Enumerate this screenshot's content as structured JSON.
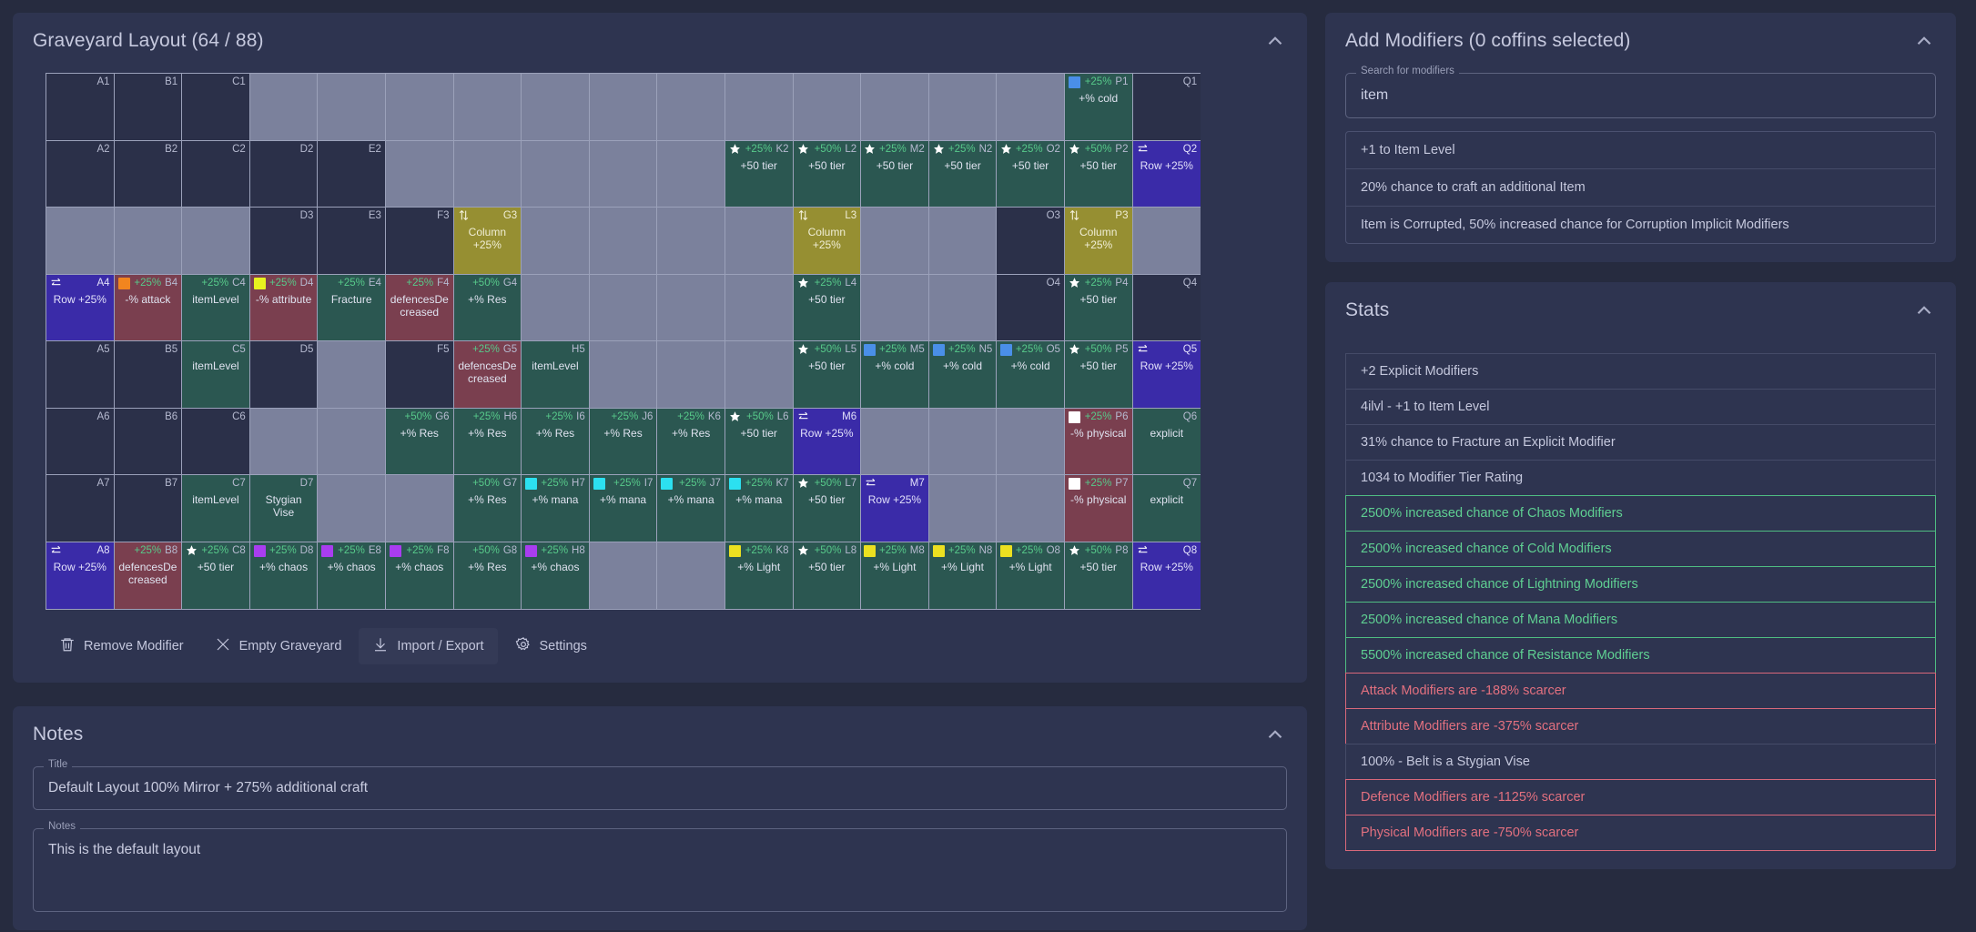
{
  "graveyard": {
    "title": "Graveyard Layout (64 / 88)",
    "collapse_icon": "chevron-up-icon",
    "columns": [
      "A",
      "B",
      "C",
      "D",
      "E",
      "F",
      "G",
      "H",
      "I",
      "J",
      "K",
      "L",
      "M",
      "N",
      "O",
      "P",
      "Q"
    ],
    "rows": 8,
    "cells": [
      [
        {
          "id": "A1",
          "state": "avail"
        },
        {
          "id": "B1",
          "state": "avail"
        },
        {
          "id": "C1",
          "state": "avail"
        },
        {
          "id": "",
          "state": "empty"
        },
        {
          "id": "",
          "state": "empty"
        },
        {
          "id": "",
          "state": "empty"
        },
        {
          "id": "",
          "state": "empty"
        },
        {
          "id": "",
          "state": "empty"
        },
        {
          "id": "",
          "state": "empty"
        },
        {
          "id": "",
          "state": "empty"
        },
        {
          "id": "",
          "state": "empty"
        },
        {
          "id": "",
          "state": "empty"
        },
        {
          "id": "",
          "state": "empty"
        },
        {
          "id": "",
          "state": "empty"
        },
        {
          "id": "",
          "state": "empty"
        },
        {
          "id": "P1",
          "state": "mod-green",
          "pct": "+25%",
          "label": "+% cold",
          "swatch": "#4a8fe8"
        },
        {
          "id": "Q1",
          "state": "avail"
        }
      ],
      [
        {
          "id": "A2",
          "state": "avail"
        },
        {
          "id": "B2",
          "state": "avail"
        },
        {
          "id": "C2",
          "state": "avail"
        },
        {
          "id": "D2",
          "state": "avail"
        },
        {
          "id": "E2",
          "state": "avail"
        },
        {
          "id": "",
          "state": "empty"
        },
        {
          "id": "",
          "state": "empty"
        },
        {
          "id": "",
          "state": "empty"
        },
        {
          "id": "",
          "state": "empty"
        },
        {
          "id": "",
          "state": "empty"
        },
        {
          "id": "K2",
          "state": "mod-green",
          "pct": "+25%",
          "label": "+50 tier",
          "icon": "star-icon"
        },
        {
          "id": "L2",
          "state": "mod-green",
          "pct": "+50%",
          "label": "+50 tier",
          "icon": "star-icon"
        },
        {
          "id": "M2",
          "state": "mod-green",
          "pct": "+25%",
          "label": "+50 tier",
          "icon": "star-icon"
        },
        {
          "id": "N2",
          "state": "mod-green",
          "pct": "+25%",
          "label": "+50 tier",
          "icon": "star-icon"
        },
        {
          "id": "O2",
          "state": "mod-green",
          "pct": "+25%",
          "label": "+50 tier",
          "icon": "star-icon"
        },
        {
          "id": "P2",
          "state": "mod-green",
          "pct": "+50%",
          "label": "+50 tier",
          "icon": "star-icon"
        },
        {
          "id": "Q2",
          "state": "mod-purple",
          "label": "Row +25%",
          "icon": "row-swap-icon"
        }
      ],
      [
        {
          "id": "",
          "state": "empty"
        },
        {
          "id": "",
          "state": "empty"
        },
        {
          "id": "",
          "state": "empty"
        },
        {
          "id": "D3",
          "state": "avail"
        },
        {
          "id": "E3",
          "state": "avail"
        },
        {
          "id": "F3",
          "state": "avail"
        },
        {
          "id": "G3",
          "state": "mod-gold",
          "label": "Column +25%",
          "icon": "column-arrows-icon"
        },
        {
          "id": "",
          "state": "empty"
        },
        {
          "id": "",
          "state": "empty"
        },
        {
          "id": "",
          "state": "empty"
        },
        {
          "id": "",
          "state": "empty"
        },
        {
          "id": "L3",
          "state": "mod-gold",
          "label": "Column +25%",
          "icon": "column-arrows-icon"
        },
        {
          "id": "",
          "state": "empty"
        },
        {
          "id": "",
          "state": "empty"
        },
        {
          "id": "O3",
          "state": "avail"
        },
        {
          "id": "P3",
          "state": "mod-gold",
          "label": "Column +25%",
          "icon": "column-arrows-icon"
        },
        {
          "id": "",
          "state": "empty"
        }
      ],
      [
        {
          "id": "A4",
          "state": "mod-purple",
          "label": "Row +25%",
          "icon": "row-swap-icon"
        },
        {
          "id": "B4",
          "state": "mod-red",
          "pct": "+25%",
          "label": "-% attack",
          "swatch": "#f2851f"
        },
        {
          "id": "C4",
          "state": "mod-green",
          "pct": "+25%",
          "label": "itemLevel"
        },
        {
          "id": "D4",
          "state": "mod-red",
          "pct": "+25%",
          "label": "-% attribute",
          "swatch": "#e8f21f"
        },
        {
          "id": "E4",
          "state": "mod-green",
          "pct": "+25%",
          "label": "Fracture"
        },
        {
          "id": "F4",
          "state": "mod-red",
          "pct": "+25%",
          "label": "defencesDecreased"
        },
        {
          "id": "G4",
          "state": "mod-green",
          "pct": "+50%",
          "label": "+% Res"
        },
        {
          "id": "",
          "state": "empty"
        },
        {
          "id": "",
          "state": "empty"
        },
        {
          "id": "",
          "state": "empty"
        },
        {
          "id": "",
          "state": "empty"
        },
        {
          "id": "L4",
          "state": "mod-green",
          "pct": "+25%",
          "label": "+50 tier",
          "icon": "star-icon"
        },
        {
          "id": "",
          "state": "empty"
        },
        {
          "id": "",
          "state": "empty"
        },
        {
          "id": "O4",
          "state": "avail"
        },
        {
          "id": "P4",
          "state": "mod-green",
          "pct": "+25%",
          "label": "+50 tier",
          "icon": "star-icon"
        },
        {
          "id": "Q4",
          "state": "avail"
        }
      ],
      [
        {
          "id": "A5",
          "state": "avail"
        },
        {
          "id": "B5",
          "state": "avail"
        },
        {
          "id": "C5",
          "state": "mod-green",
          "label": "itemLevel"
        },
        {
          "id": "D5",
          "state": "avail"
        },
        {
          "id": "",
          "state": "empty"
        },
        {
          "id": "F5",
          "state": "avail"
        },
        {
          "id": "G5",
          "state": "mod-red",
          "pct": "+25%",
          "label": "defencesDecreased"
        },
        {
          "id": "H5",
          "state": "mod-green",
          "label": "itemLevel"
        },
        {
          "id": "",
          "state": "empty"
        },
        {
          "id": "",
          "state": "empty"
        },
        {
          "id": "",
          "state": "empty"
        },
        {
          "id": "L5",
          "state": "mod-green",
          "pct": "+50%",
          "label": "+50 tier",
          "icon": "star-icon"
        },
        {
          "id": "M5",
          "state": "mod-green",
          "pct": "+25%",
          "label": "+% cold",
          "swatch": "#4a8fe8"
        },
        {
          "id": "N5",
          "state": "mod-green",
          "pct": "+25%",
          "label": "+% cold",
          "swatch": "#4a8fe8"
        },
        {
          "id": "O5",
          "state": "mod-green",
          "pct": "+25%",
          "label": "+% cold",
          "swatch": "#4a8fe8"
        },
        {
          "id": "P5",
          "state": "mod-green",
          "pct": "+50%",
          "label": "+50 tier",
          "icon": "star-icon"
        },
        {
          "id": "Q5",
          "state": "mod-purple",
          "label": "Row +25%",
          "icon": "row-swap-icon"
        }
      ],
      [
        {
          "id": "A6",
          "state": "avail"
        },
        {
          "id": "B6",
          "state": "avail"
        },
        {
          "id": "C6",
          "state": "avail"
        },
        {
          "id": "",
          "state": "empty"
        },
        {
          "id": "",
          "state": "empty"
        },
        {
          "id": "G6",
          "state": "mod-green",
          "pct": "+50%",
          "label": "+% Res"
        },
        {
          "id": "H6",
          "state": "mod-green",
          "pct": "+25%",
          "label": "+% Res"
        },
        {
          "id": "I6",
          "state": "mod-green",
          "pct": "+25%",
          "label": "+% Res"
        },
        {
          "id": "J6",
          "state": "mod-green",
          "pct": "+25%",
          "label": "+% Res"
        },
        {
          "id": "K6",
          "state": "mod-green",
          "pct": "+25%",
          "label": "+% Res"
        },
        {
          "id": "L6",
          "state": "mod-green",
          "pct": "+50%",
          "label": "+50 tier",
          "icon": "star-icon"
        },
        {
          "id": "M6",
          "state": "mod-purple",
          "label": "Row +25%",
          "icon": "row-swap-icon"
        },
        {
          "id": "",
          "state": "empty"
        },
        {
          "id": "",
          "state": "empty"
        },
        {
          "id": "",
          "state": "empty"
        },
        {
          "id": "P6",
          "state": "mod-red",
          "pct": "+25%",
          "label": "-% physical",
          "swatch": "#ffffff"
        },
        {
          "id": "Q6",
          "state": "mod-green",
          "label": "explicit"
        }
      ],
      [
        {
          "id": "A7",
          "state": "avail"
        },
        {
          "id": "B7",
          "state": "avail"
        },
        {
          "id": "C7",
          "state": "mod-green",
          "label": "itemLevel"
        },
        {
          "id": "D7",
          "state": "mod-green",
          "label": "Stygian Vise"
        },
        {
          "id": "",
          "state": "empty"
        },
        {
          "id": "",
          "state": "empty"
        },
        {
          "id": "G7",
          "state": "mod-green",
          "pct": "+50%",
          "label": "+% Res"
        },
        {
          "id": "H7",
          "state": "mod-green",
          "pct": "+25%",
          "label": "+% mana",
          "swatch": "#2ce0f0"
        },
        {
          "id": "I7",
          "state": "mod-green",
          "pct": "+25%",
          "label": "+% mana",
          "swatch": "#2ce0f0"
        },
        {
          "id": "J7",
          "state": "mod-green",
          "pct": "+25%",
          "label": "+% mana",
          "swatch": "#2ce0f0"
        },
        {
          "id": "K7",
          "state": "mod-green",
          "pct": "+25%",
          "label": "+% mana",
          "swatch": "#2ce0f0"
        },
        {
          "id": "L7",
          "state": "mod-green",
          "pct": "+50%",
          "label": "+50 tier",
          "icon": "star-icon"
        },
        {
          "id": "M7",
          "state": "mod-purple",
          "label": "Row +25%",
          "icon": "row-swap-icon"
        },
        {
          "id": "",
          "state": "empty"
        },
        {
          "id": "",
          "state": "empty"
        },
        {
          "id": "P7",
          "state": "mod-red",
          "pct": "+25%",
          "label": "-% physical",
          "swatch": "#ffffff"
        },
        {
          "id": "Q7",
          "state": "mod-green",
          "label": "explicit"
        }
      ],
      [
        {
          "id": "A8",
          "state": "mod-purple",
          "label": "Row +25%",
          "icon": "row-swap-icon"
        },
        {
          "id": "B8",
          "state": "mod-red",
          "pct": "+25%",
          "label": "defencesDecreased"
        },
        {
          "id": "C8",
          "state": "mod-green",
          "pct": "+25%",
          "label": "+50 tier",
          "icon": "star-icon"
        },
        {
          "id": "D8",
          "state": "mod-green",
          "pct": "+25%",
          "label": "+% chaos",
          "swatch": "#a93df0"
        },
        {
          "id": "E8",
          "state": "mod-green",
          "pct": "+25%",
          "label": "+% chaos",
          "swatch": "#a93df0"
        },
        {
          "id": "F8",
          "state": "mod-green",
          "pct": "+25%",
          "label": "+% chaos",
          "swatch": "#a93df0"
        },
        {
          "id": "G8",
          "state": "mod-green",
          "pct": "+50%",
          "label": "+% Res"
        },
        {
          "id": "H8",
          "state": "mod-green",
          "pct": "+25%",
          "label": "+% chaos",
          "swatch": "#a93df0"
        },
        {
          "id": "",
          "state": "empty"
        },
        {
          "id": "",
          "state": "empty"
        },
        {
          "id": "K8",
          "state": "mod-green",
          "pct": "+25%",
          "label": "+% Light",
          "swatch": "#ece020"
        },
        {
          "id": "L8",
          "state": "mod-green",
          "pct": "+50%",
          "label": "+50 tier",
          "icon": "star-icon"
        },
        {
          "id": "M8",
          "state": "mod-green",
          "pct": "+25%",
          "label": "+% Light",
          "swatch": "#ece020"
        },
        {
          "id": "N8",
          "state": "mod-green",
          "pct": "+25%",
          "label": "+% Light",
          "swatch": "#ece020"
        },
        {
          "id": "O8",
          "state": "mod-green",
          "pct": "+25%",
          "label": "+% Light",
          "swatch": "#ece020"
        },
        {
          "id": "P8",
          "state": "mod-green",
          "pct": "+50%",
          "label": "+50 tier",
          "icon": "star-icon"
        },
        {
          "id": "Q8",
          "state": "mod-purple",
          "label": "Row +25%",
          "icon": "row-swap-icon"
        }
      ]
    ],
    "toolbar": [
      {
        "label": "Remove Modifier",
        "icon": "trash-icon",
        "active": false
      },
      {
        "label": "Empty Graveyard",
        "icon": "close-x-icon",
        "active": false
      },
      {
        "label": "Import / Export",
        "icon": "download-icon",
        "active": true
      },
      {
        "label": "Settings",
        "icon": "gear-icon",
        "active": false
      }
    ]
  },
  "notes": {
    "title": "Notes",
    "collapse_icon": "chevron-up-icon",
    "title_legend": "Title",
    "title_value": "Default Layout 100% Mirror + 275% additional craft",
    "notes_legend": "Notes",
    "notes_value": "This is the default layout"
  },
  "add_modifiers": {
    "title": "Add Modifiers (0 coffins selected)",
    "collapse_icon": "chevron-up-icon",
    "search_legend": "Search for modifiers",
    "search_value": "item",
    "results": [
      "+1 to Item Level",
      "20% chance to craft an additional Item",
      "Item is Corrupted, 50% increased chance for Corruption Implicit Modifiers"
    ]
  },
  "stats": {
    "title": "Stats",
    "collapse_icon": "chevron-up-icon",
    "items": [
      {
        "text": "+2 Explicit Modifiers",
        "tone": "neutral"
      },
      {
        "text": "4ilvl - +1 to Item Level",
        "tone": "neutral"
      },
      {
        "text": "31% chance to Fracture an Explicit Modifier",
        "tone": "neutral"
      },
      {
        "text": "1034 to Modifier Tier Rating",
        "tone": "neutral"
      },
      {
        "text": "2500% increased chance of Chaos Modifiers",
        "tone": "pos"
      },
      {
        "text": "2500% increased chance of Cold Modifiers",
        "tone": "pos"
      },
      {
        "text": "2500% increased chance of Lightning Modifiers",
        "tone": "pos"
      },
      {
        "text": "2500% increased chance of Mana Modifiers",
        "tone": "pos"
      },
      {
        "text": "5500% increased chance of Resistance Modifiers",
        "tone": "pos"
      },
      {
        "text": "Attack Modifiers are -188% scarcer",
        "tone": "neg"
      },
      {
        "text": "Attribute Modifiers are -375% scarcer",
        "tone": "neg"
      },
      {
        "text": "100% - Belt is a Stygian Vise",
        "tone": "neutral"
      },
      {
        "text": "Defence Modifiers are -1125% scarcer",
        "tone": "neg"
      },
      {
        "text": "Physical Modifiers are -750% scarcer",
        "tone": "neg"
      }
    ]
  },
  "colors": {
    "bg": "#262b3f",
    "card": "#2e3450",
    "cell_empty": "#7b819c",
    "cell_avail": "#2b3049",
    "mod_green": "#2b5751",
    "mod_red": "#7a3f4f",
    "mod_purple": "#3a2ba8",
    "mod_gold": "#968f32",
    "pct_green": "#57c98a",
    "stat_pos": "#5fcf92",
    "stat_neg": "#e2707f"
  }
}
